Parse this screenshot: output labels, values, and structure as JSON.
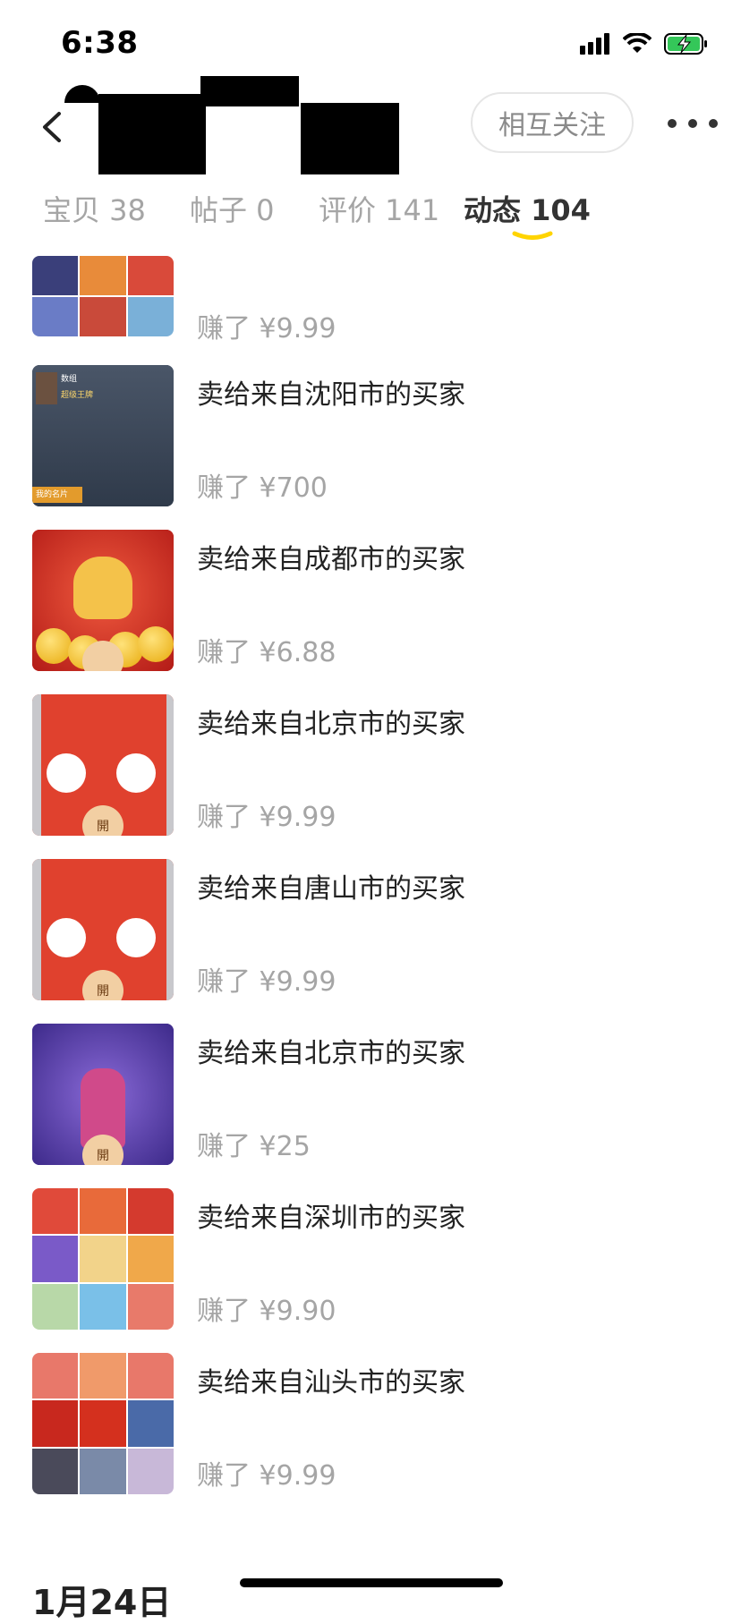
{
  "status_bar": {
    "time": "6:38",
    "icons": [
      "signal-icon",
      "wifi-icon",
      "battery-charging-icon"
    ]
  },
  "header": {
    "back_icon": "chevron-left-icon",
    "follow_label": "相互关注",
    "more_icon": "more-dots-icon"
  },
  "tabs": [
    {
      "label": "宝贝 38",
      "active": false
    },
    {
      "label": "帖子 0",
      "active": false
    },
    {
      "label": "评价 141",
      "active": false
    },
    {
      "label": "动态 104",
      "active": true
    }
  ],
  "accent_color": "#ffd400",
  "items": [
    {
      "title": "",
      "price": "赚了 ¥9.99",
      "thumb": "sticker-grid"
    },
    {
      "title": "卖给来自沈阳市的买家",
      "price": "赚了 ¥700",
      "thumb": "game-profile-card"
    },
    {
      "title": "卖给来自成都市的买家",
      "price": "赚了 ¥6.88",
      "thumb": "ox-red-envelope"
    },
    {
      "title": "卖给来自北京市的买家",
      "price": "赚了 ¥9.99",
      "thumb": "pig-red-envelope"
    },
    {
      "title": "卖给来自唐山市的买家",
      "price": "赚了 ¥9.99",
      "thumb": "pig-red-envelope"
    },
    {
      "title": "卖给来自北京市的买家",
      "price": "赚了 ¥25",
      "thumb": "purple-hero-envelope"
    },
    {
      "title": "卖给来自深圳市的买家",
      "price": "赚了 ¥9.90",
      "thumb": "sticker-grid-2"
    },
    {
      "title": "卖给来自汕头市的买家",
      "price": "赚了 ¥9.99",
      "thumb": "new-year-grid"
    }
  ],
  "thumb_texts": {
    "profile_name": "数组",
    "profile_rank": "超级王牌",
    "profile_card": "我的名片",
    "open": "開"
  },
  "date_heading": "1月24日"
}
